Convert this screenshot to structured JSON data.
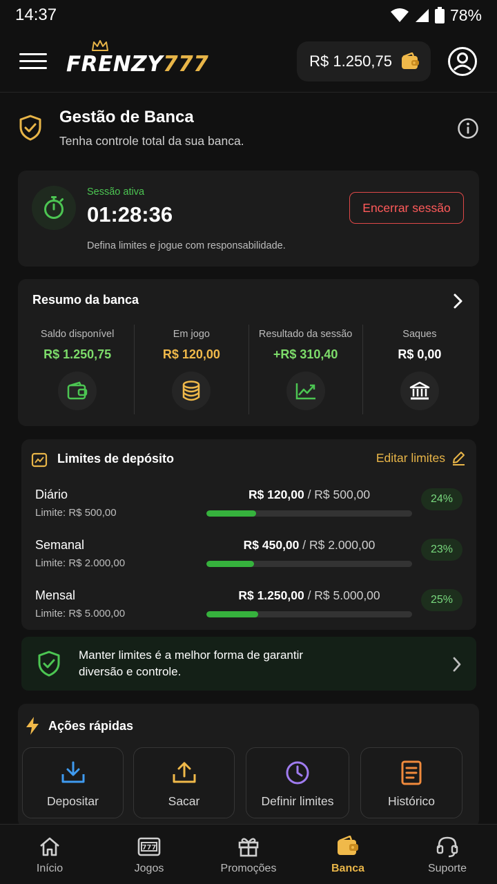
{
  "status_bar": {
    "time": "14:37",
    "battery": "78%"
  },
  "header": {
    "logo_white": "FRENZY",
    "logo_gold": "777",
    "balance": "R$ 1.250,75"
  },
  "page": {
    "title": "Gestão de Banca",
    "subtitle": "Tenha controle total da sua banca."
  },
  "session": {
    "label": "Sessão ativa",
    "time": "01:28:36",
    "note": "Defina limites e jogue com responsabilidade.",
    "end_button": "Encerrar sessão"
  },
  "summary": {
    "title": "Resumo da banca",
    "items": [
      {
        "label": "Saldo disponível",
        "value": "R$ 1.250,75",
        "color": "#7ddc6a",
        "icon": "wallet-icon"
      },
      {
        "label": "Em jogo",
        "value": "R$ 120,00",
        "color": "#f0b94a",
        "icon": "coins-icon"
      },
      {
        "label": "Resultado da sessão",
        "value": "+R$ 310,40",
        "color": "#7ddc6a",
        "icon": "trend-up-icon"
      },
      {
        "label": "Saques",
        "value": "R$ 0,00",
        "color": "#ffffff",
        "icon": "bank-icon"
      }
    ]
  },
  "limits": {
    "title": "Limites de depósito",
    "edit_label": "Editar limites",
    "rows": [
      {
        "name": "Diário",
        "limit": "Limite: R$ 500,00",
        "used": "R$ 120,00",
        "total": " / R$ 500,00",
        "percent": "24%",
        "fraction": 0.24
      },
      {
        "name": "Semanal",
        "limit": "Limite: R$ 2.000,00",
        "used": "R$ 450,00",
        "total": " / R$ 2.000,00",
        "percent": "23%",
        "fraction": 0.23
      },
      {
        "name": "Mensal",
        "limit": "Limite: R$ 5.000,00",
        "used": "R$ 1.250,00",
        "total": " / R$ 5.000,00",
        "percent": "25%",
        "fraction": 0.25
      }
    ]
  },
  "tip": {
    "text": "Manter limites é a melhor forma de garantir diversão e controle."
  },
  "quick_actions": {
    "title": "Ações rápidas",
    "items": [
      {
        "label": "Depositar",
        "icon": "download-icon",
        "color": "#3f9bf0"
      },
      {
        "label": "Sacar",
        "icon": "upload-icon",
        "color": "#f0b94a"
      },
      {
        "label": "Definir limites",
        "icon": "clock-icon",
        "color": "#a07cf0"
      },
      {
        "label": "Histórico",
        "icon": "document-icon",
        "color": "#f08a3c"
      }
    ]
  },
  "nav": {
    "items": [
      {
        "label": "Início",
        "icon": "home-icon"
      },
      {
        "label": "Jogos",
        "icon": "slot-machine-icon"
      },
      {
        "label": "Promoções",
        "icon": "gift-icon"
      },
      {
        "label": "Banca",
        "icon": "wallet-icon",
        "active": true
      },
      {
        "label": "Suporte",
        "icon": "headset-icon"
      }
    ]
  },
  "colors": {
    "accent": "#e8b548",
    "success": "#36b23d",
    "danger": "#e04848"
  }
}
